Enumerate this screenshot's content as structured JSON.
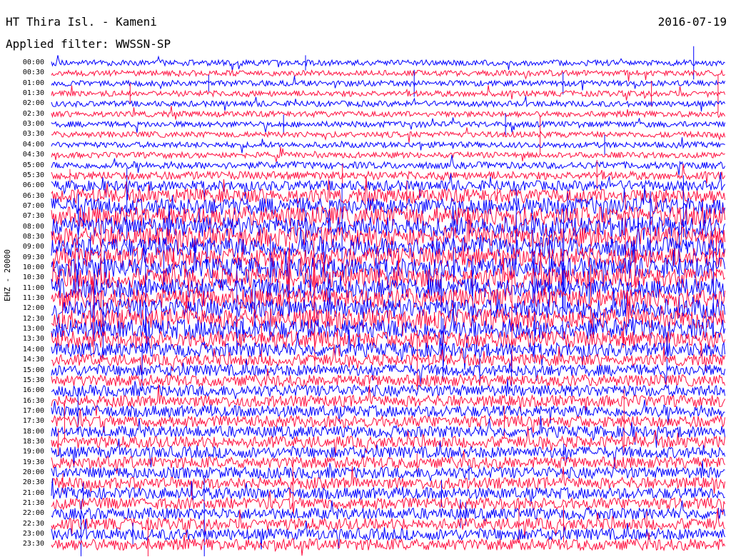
{
  "chart_data": {
    "type": "line",
    "title": "HT Thira Isl. - Kameni",
    "subtitle": "Applied filter: WWSSN-SP",
    "date": "2016-07-19",
    "ylabel": "EHZ - 20000",
    "row_labels": [
      "00:00",
      "00:30",
      "01:00",
      "01:30",
      "02:00",
      "02:30",
      "03:00",
      "03:30",
      "04:00",
      "04:30",
      "05:00",
      "05:30",
      "06:00",
      "06:30",
      "07:00",
      "07:30",
      "08:00",
      "08:30",
      "09:00",
      "09:30",
      "10:00",
      "10:30",
      "11:00",
      "11:30",
      "12:00",
      "12:30",
      "13:00",
      "13:30",
      "14:00",
      "14:30",
      "15:00",
      "15:30",
      "16:00",
      "16:30",
      "17:00",
      "17:30",
      "18:00",
      "18:30",
      "19:00",
      "19:30",
      "20:00",
      "20:30",
      "21:00",
      "21:30",
      "22:00",
      "22:30",
      "23:00",
      "23:30"
    ],
    "series_colors": [
      "#0000ff",
      "#ff1040"
    ],
    "amplitude_by_row": [
      1,
      1,
      1,
      1,
      1,
      1,
      1,
      1,
      1,
      1,
      1.2,
      1.4,
      1.8,
      2.5,
      3,
      3.5,
      3.5,
      3.5,
      3.5,
      3.5,
      3.5,
      3.5,
      3.5,
      3.5,
      3.5,
      3.5,
      3.5,
      3,
      2.5,
      2,
      2,
      2,
      2,
      2,
      2,
      2,
      2,
      2,
      2,
      2,
      2,
      2,
      2,
      2,
      2,
      2,
      2,
      2
    ]
  }
}
